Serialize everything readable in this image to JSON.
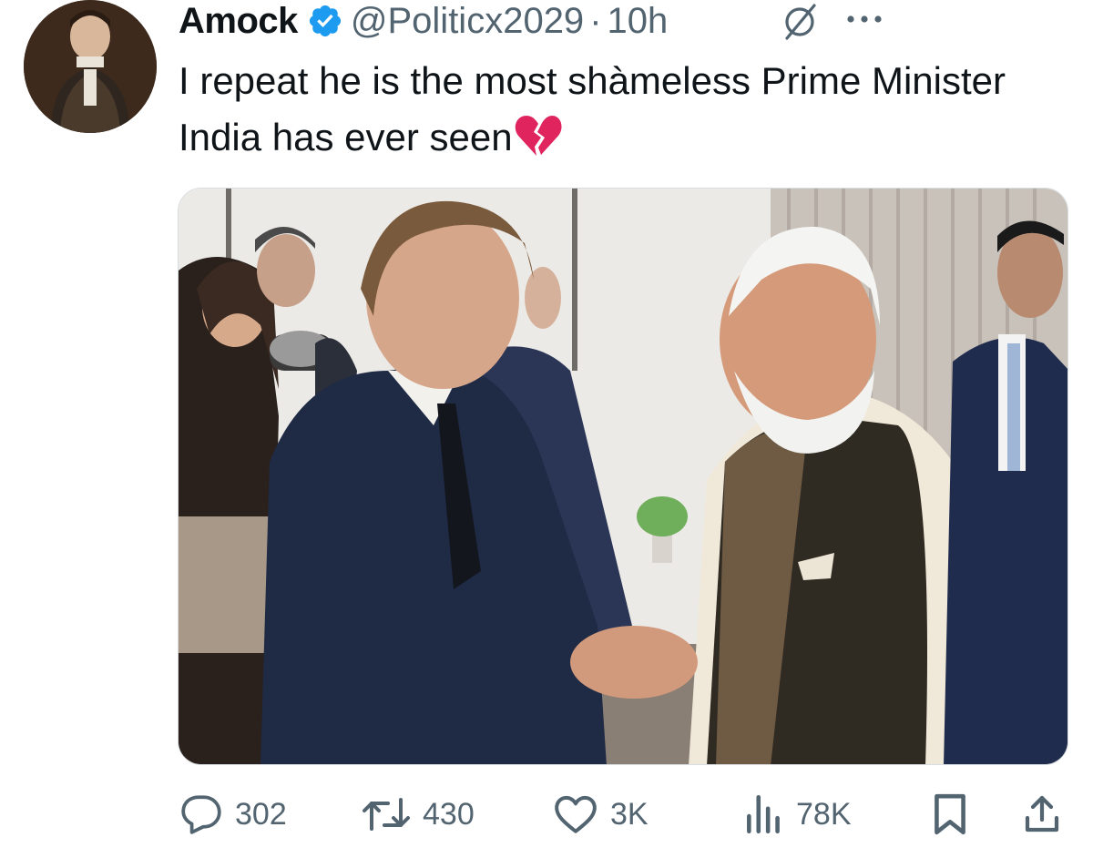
{
  "tweet": {
    "author_name": "Amock",
    "handle": "@Politicx2029",
    "separator": "·",
    "time": "10h",
    "text": "I repeat he is the most shàmeless Prime Minister India has ever seen",
    "emoji": "broken-heart"
  },
  "icons": {
    "verified": "verified-badge-icon",
    "grok": "grok-icon",
    "more": "more-icon",
    "reply": "reply-icon",
    "retweet": "retweet-icon",
    "like": "like-icon",
    "views": "views-icon",
    "bookmark": "bookmark-icon",
    "share": "share-icon"
  },
  "metrics": {
    "replies": "302",
    "retweets": "430",
    "likes": "3K",
    "views": "78K"
  },
  "colors": {
    "verified_blue": "#1d9bf0",
    "text_primary": "#0f1419",
    "text_secondary": "#536471",
    "broken_heart": "#e0245e"
  }
}
